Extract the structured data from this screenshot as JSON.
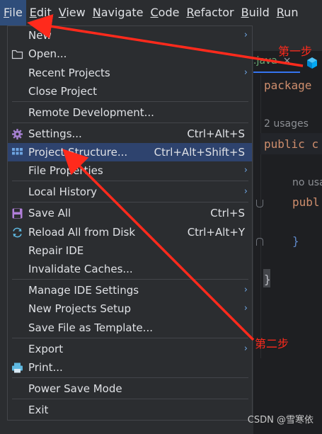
{
  "menubar": {
    "items": [
      {
        "mnemonic": "F",
        "rest": "ile"
      },
      {
        "mnemonic": "E",
        "rest": "dit"
      },
      {
        "mnemonic": "V",
        "rest": "iew"
      },
      {
        "mnemonic": "N",
        "rest": "avigate"
      },
      {
        "mnemonic": "C",
        "rest": "ode"
      },
      {
        "mnemonic": "R",
        "rest": "efactor"
      },
      {
        "mnemonic": "B",
        "rest": "uild"
      },
      {
        "mnemonic": "R",
        "rest": "un"
      }
    ]
  },
  "editor": {
    "tab_name": ".java",
    "tab_close": "×",
    "line1_keyword": "package",
    "usages_hint": "2 usages",
    "line2_keyword": "public",
    "line2_rest": "c",
    "no_usages_hint": "no usa",
    "line3_keyword": "publ",
    "close_brace_inner": "}",
    "close_brace_outer": "}"
  },
  "file_menu": {
    "items": {
      "new": {
        "label": "New"
      },
      "open": {
        "label": "Open..."
      },
      "recent": {
        "label": "Recent Projects"
      },
      "close": {
        "label": "Close Project"
      },
      "remote": {
        "label": "Remote Development..."
      },
      "settings": {
        "label": "Settings...",
        "shortcut": "Ctrl+Alt+S"
      },
      "structure": {
        "label": "Project Structure...",
        "shortcut": "Ctrl+Alt+Shift+S"
      },
      "props": {
        "label": "File Properties"
      },
      "history": {
        "label": "Local History"
      },
      "saveall": {
        "label": "Save All",
        "shortcut": "Ctrl+S"
      },
      "reload": {
        "label": "Reload All from Disk",
        "shortcut": "Ctrl+Alt+Y"
      },
      "repair": {
        "label": "Repair IDE"
      },
      "invalidate": {
        "label": "Invalidate Caches..."
      },
      "manage": {
        "label": "Manage IDE Settings"
      },
      "newsetup": {
        "label": "New Projects Setup"
      },
      "template": {
        "label": "Save File as Template..."
      },
      "export": {
        "label": "Export"
      },
      "print": {
        "label": "Print..."
      },
      "power": {
        "label": "Power Save Mode"
      },
      "exit": {
        "label": "Exit"
      }
    },
    "submenu_arrow": "›"
  },
  "annotations": {
    "step1": "第一步",
    "step2": "第二步",
    "color": "#ff2a1c"
  },
  "watermark": "CSDN @雪寒依",
  "colors": {
    "selection": "#2e436e",
    "menu_active": "#2f4d7a",
    "keyword": "#cf8e6d"
  }
}
